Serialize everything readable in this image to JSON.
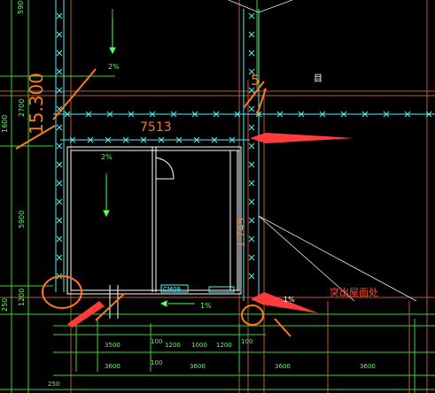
{
  "drawing": {
    "background": "#000000",
    "colors": {
      "axis_lines": "#cc6a3a",
      "dimension": "#5aff5a",
      "walls": "#4ff2f2",
      "interior": "#ffffff",
      "markup": "#ff7a1a",
      "arrows": "#ff3b3b",
      "slope": "#3ad23a"
    },
    "labels": {
      "top_5900": "5900",
      "left_1600": "1600",
      "left_5900": "5900",
      "left_1200": "1200",
      "left_250": "250",
      "left_2700": "2700",
      "slope_top": "2%",
      "slope_room": "2%",
      "slope_bottom": "1%",
      "slope_right": "1%",
      "room_length": "7513",
      "big_left_text": "15.300",
      "small_5": "5",
      "vertical_right_text": "1.745",
      "door_label": "CM09",
      "box_glyph": "目",
      "callout": "突出屋面处",
      "bottom_row1": [
        "3500",
        "100",
        "1200",
        "1000",
        "1200",
        "100"
      ],
      "bottom_row2": [
        "3600",
        "100",
        "3600",
        "3600",
        "3600"
      ],
      "bottom_250": "250"
    },
    "icons": [
      "cross-marker-icon",
      "arrow-pointer-icon",
      "circle-markup-icon"
    ]
  }
}
